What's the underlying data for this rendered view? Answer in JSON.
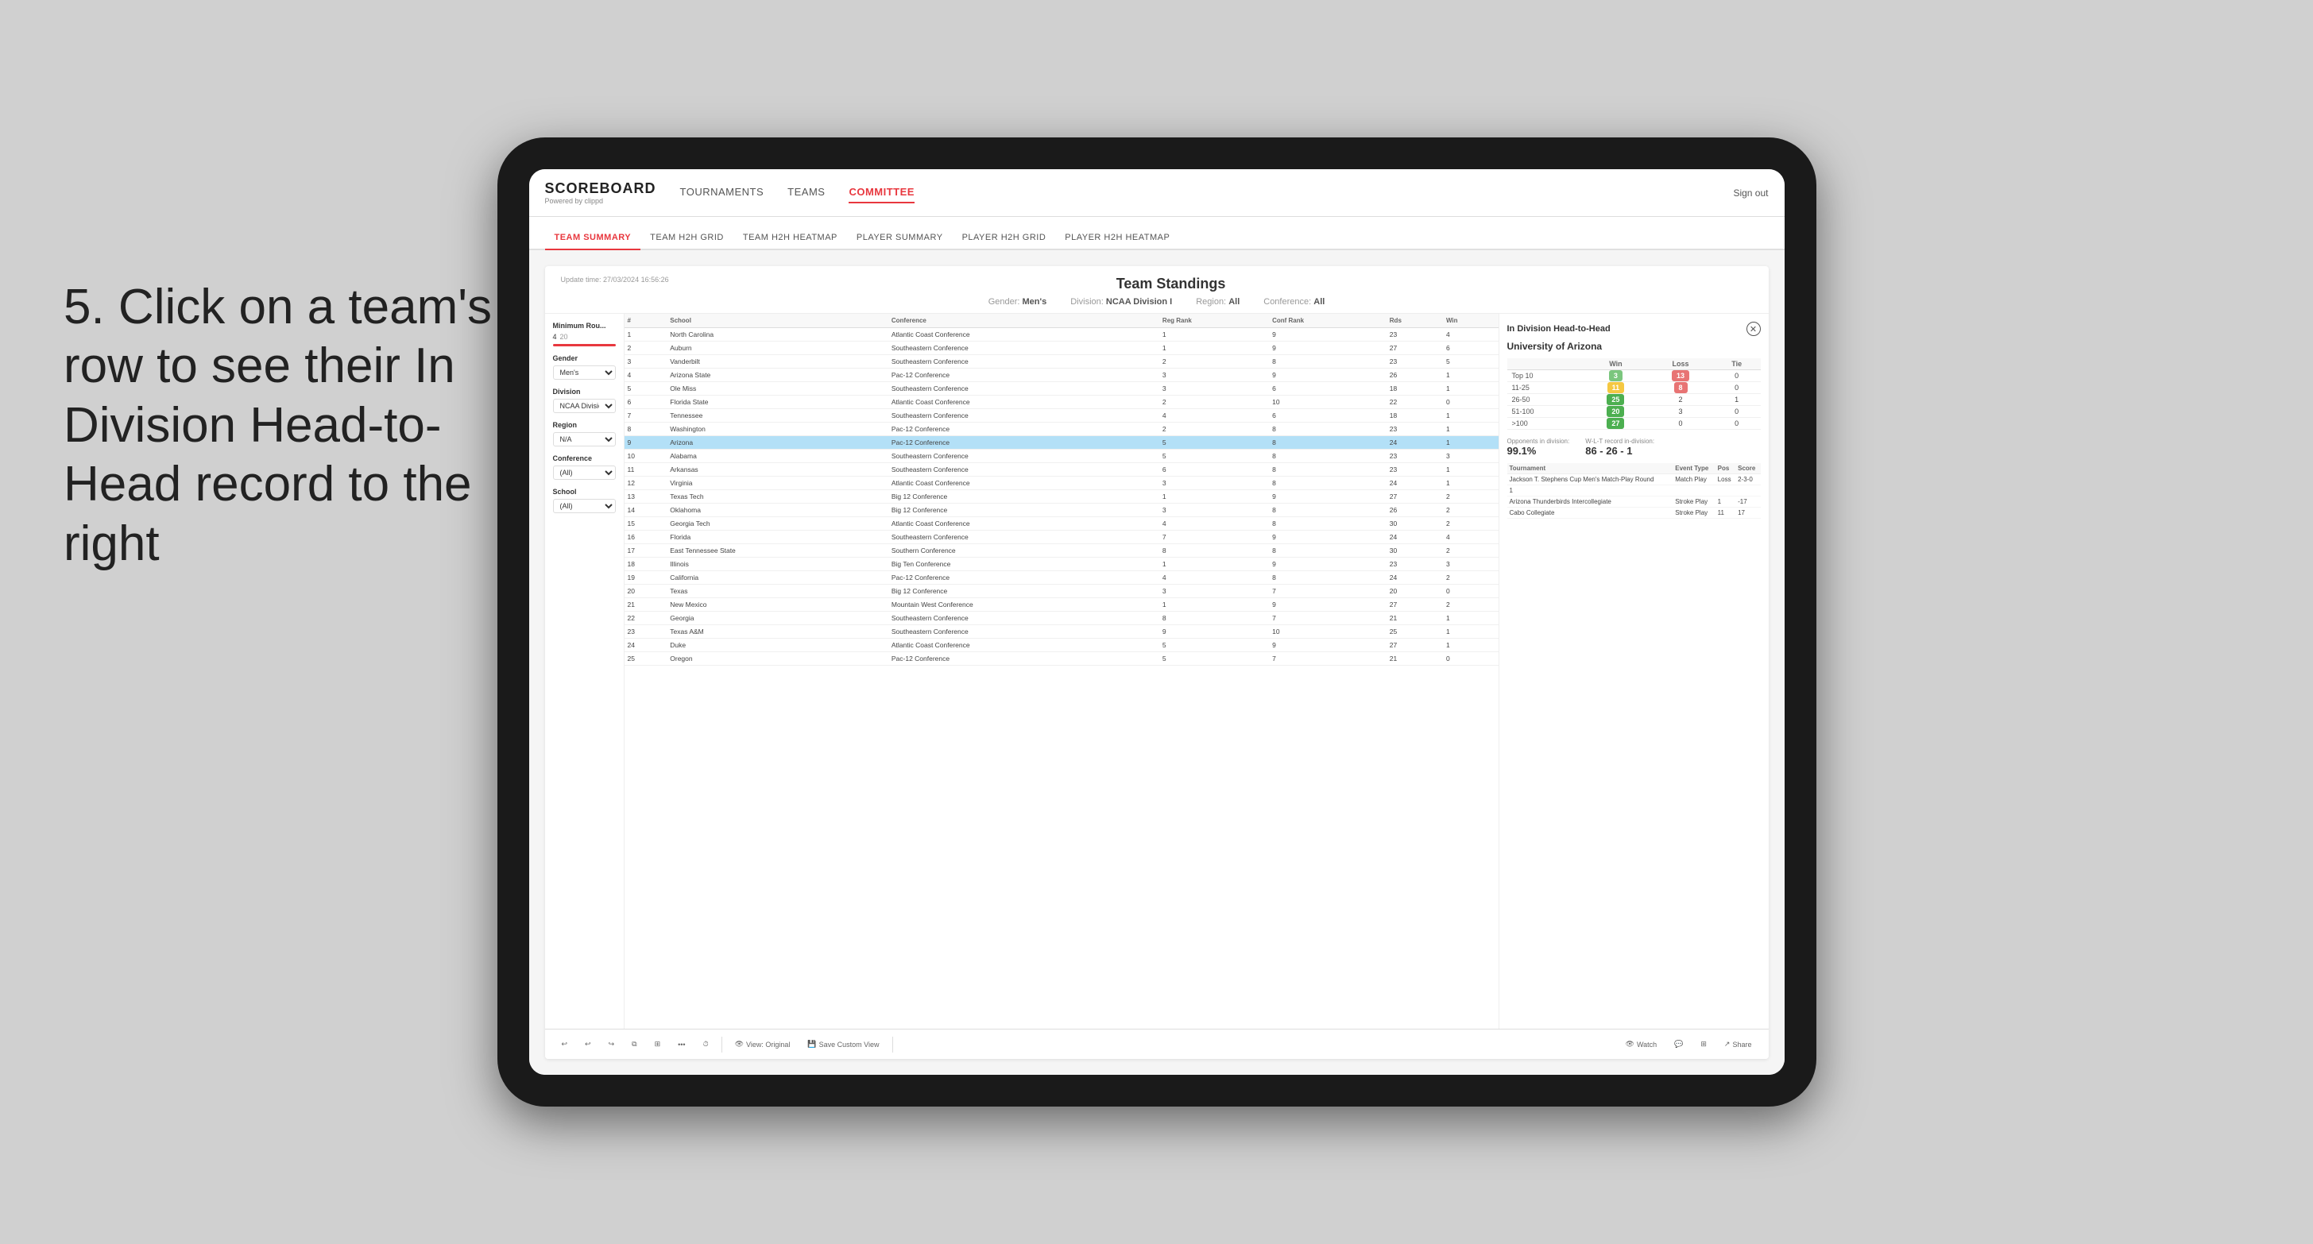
{
  "annotation": {
    "text": "5. Click on a team's row to see their In Division Head-to-Head record to the right"
  },
  "app": {
    "logo": "SCOREBOARD",
    "logo_sub": "Powered by clippd",
    "nav_items": [
      "TOURNAMENTS",
      "TEAMS",
      "COMMITTEE"
    ],
    "active_nav": "COMMITTEE",
    "sign_out": "Sign out"
  },
  "sub_nav": {
    "items": [
      "TEAM SUMMARY",
      "TEAM H2H GRID",
      "TEAM H2H HEATMAP",
      "PLAYER SUMMARY",
      "PLAYER H2H GRID",
      "PLAYER H2H HEATMAP"
    ],
    "active": "PLAYER SUMMARY"
  },
  "card": {
    "update_time": "Update time: 27/03/2024 16:56:26",
    "title": "Team Standings",
    "filters": {
      "gender_label": "Gender:",
      "gender_value": "Men's",
      "division_label": "Division:",
      "division_value": "NCAA Division I",
      "region_label": "Region:",
      "region_value": "All",
      "conference_label": "Conference:",
      "conference_value": "All"
    }
  },
  "left_filters": {
    "min_rounds_label": "Minimum Rou...",
    "min_rounds_value": "4",
    "min_rounds_max": "20",
    "gender_label": "Gender",
    "gender_value": "Men's",
    "division_label": "Division",
    "division_value": "NCAA Division I",
    "region_label": "Region",
    "region_value": "N/A",
    "conference_label": "Conference",
    "conference_value": "(All)",
    "school_label": "School",
    "school_value": "(All)"
  },
  "table": {
    "columns": [
      "#",
      "School",
      "Conference",
      "Reg Rank",
      "Conf Rank",
      "Rds",
      "Win"
    ],
    "rows": [
      {
        "rank": 1,
        "school": "North Carolina",
        "conference": "Atlantic Coast Conference",
        "reg_rank": 1,
        "conf_rank": 9,
        "rds": 23,
        "win": 4
      },
      {
        "rank": 2,
        "school": "Auburn",
        "conference": "Southeastern Conference",
        "reg_rank": 1,
        "conf_rank": 9,
        "rds": 27,
        "win": 6
      },
      {
        "rank": 3,
        "school": "Vanderbilt",
        "conference": "Southeastern Conference",
        "reg_rank": 2,
        "conf_rank": 8,
        "rds": 23,
        "win": 5
      },
      {
        "rank": 4,
        "school": "Arizona State",
        "conference": "Pac-12 Conference",
        "reg_rank": 3,
        "conf_rank": 9,
        "rds": 26,
        "win": 1
      },
      {
        "rank": 5,
        "school": "Ole Miss",
        "conference": "Southeastern Conference",
        "reg_rank": 3,
        "conf_rank": 6,
        "rds": 18,
        "win": 1
      },
      {
        "rank": 6,
        "school": "Florida State",
        "conference": "Atlantic Coast Conference",
        "reg_rank": 2,
        "conf_rank": 10,
        "rds": 22,
        "win": 0
      },
      {
        "rank": 7,
        "school": "Tennessee",
        "conference": "Southeastern Conference",
        "reg_rank": 4,
        "conf_rank": 6,
        "rds": 18,
        "win": 1
      },
      {
        "rank": 8,
        "school": "Washington",
        "conference": "Pac-12 Conference",
        "reg_rank": 2,
        "conf_rank": 8,
        "rds": 23,
        "win": 1
      },
      {
        "rank": 9,
        "school": "Arizona",
        "conference": "Pac-12 Conference",
        "reg_rank": 5,
        "conf_rank": 8,
        "rds": 24,
        "win": 1,
        "selected": true
      },
      {
        "rank": 10,
        "school": "Alabama",
        "conference": "Southeastern Conference",
        "reg_rank": 5,
        "conf_rank": 8,
        "rds": 23,
        "win": 3
      },
      {
        "rank": 11,
        "school": "Arkansas",
        "conference": "Southeastern Conference",
        "reg_rank": 6,
        "conf_rank": 8,
        "rds": 23,
        "win": 1
      },
      {
        "rank": 12,
        "school": "Virginia",
        "conference": "Atlantic Coast Conference",
        "reg_rank": 3,
        "conf_rank": 8,
        "rds": 24,
        "win": 1
      },
      {
        "rank": 13,
        "school": "Texas Tech",
        "conference": "Big 12 Conference",
        "reg_rank": 1,
        "conf_rank": 9,
        "rds": 27,
        "win": 2
      },
      {
        "rank": 14,
        "school": "Oklahoma",
        "conference": "Big 12 Conference",
        "reg_rank": 3,
        "conf_rank": 8,
        "rds": 26,
        "win": 2
      },
      {
        "rank": 15,
        "school": "Georgia Tech",
        "conference": "Atlantic Coast Conference",
        "reg_rank": 4,
        "conf_rank": 8,
        "rds": 30,
        "win": 2
      },
      {
        "rank": 16,
        "school": "Florida",
        "conference": "Southeastern Conference",
        "reg_rank": 7,
        "conf_rank": 9,
        "rds": 24,
        "win": 4
      },
      {
        "rank": 17,
        "school": "East Tennessee State",
        "conference": "Southern Conference",
        "reg_rank": 8,
        "conf_rank": 8,
        "rds": 30,
        "win": 2
      },
      {
        "rank": 18,
        "school": "Illinois",
        "conference": "Big Ten Conference",
        "reg_rank": 1,
        "conf_rank": 9,
        "rds": 23,
        "win": 3
      },
      {
        "rank": 19,
        "school": "California",
        "conference": "Pac-12 Conference",
        "reg_rank": 4,
        "conf_rank": 8,
        "rds": 24,
        "win": 2
      },
      {
        "rank": 20,
        "school": "Texas",
        "conference": "Big 12 Conference",
        "reg_rank": 3,
        "conf_rank": 7,
        "rds": 20,
        "win": 0
      },
      {
        "rank": 21,
        "school": "New Mexico",
        "conference": "Mountain West Conference",
        "reg_rank": 1,
        "conf_rank": 9,
        "rds": 27,
        "win": 2
      },
      {
        "rank": 22,
        "school": "Georgia",
        "conference": "Southeastern Conference",
        "reg_rank": 8,
        "conf_rank": 7,
        "rds": 21,
        "win": 1
      },
      {
        "rank": 23,
        "school": "Texas A&M",
        "conference": "Southeastern Conference",
        "reg_rank": 9,
        "conf_rank": 10,
        "rds": 25,
        "win": 1
      },
      {
        "rank": 24,
        "school": "Duke",
        "conference": "Atlantic Coast Conference",
        "reg_rank": 5,
        "conf_rank": 9,
        "rds": 27,
        "win": 1
      },
      {
        "rank": 25,
        "school": "Oregon",
        "conference": "Pac-12 Conference",
        "reg_rank": 5,
        "conf_rank": 7,
        "rds": 21,
        "win": 0
      }
    ]
  },
  "h2h": {
    "title": "In Division Head-to-Head",
    "team": "University of Arizona",
    "columns": [
      "",
      "Win",
      "Loss",
      "Tie"
    ],
    "rows": [
      {
        "range": "Top 10",
        "win": 3,
        "loss": 13,
        "tie": 0,
        "win_color": "green",
        "loss_color": "red"
      },
      {
        "range": "11-25",
        "win": 11,
        "loss": 8,
        "tie": 0,
        "win_color": "yellow",
        "loss_color": "yellow"
      },
      {
        "range": "26-50",
        "win": 25,
        "loss": 2,
        "tie": 1,
        "win_color": "dk-green",
        "loss_color": ""
      },
      {
        "range": "51-100",
        "win": 20,
        "loss": 3,
        "tie": 0,
        "win_color": "dk-green",
        "loss_color": ""
      },
      {
        "range": ">100",
        "win": 27,
        "loss": 0,
        "tie": 0,
        "win_color": "dk-green",
        "loss_color": ""
      }
    ],
    "opponents_label": "Opponents in division:",
    "opponents_value": "99.1%",
    "record_label": "W-L-T record in-division:",
    "record_value": "86 - 26 - 1",
    "tournament_label": "Tournament",
    "tournament_columns": [
      "Tournament",
      "Event Type",
      "Pos",
      "Score"
    ],
    "tournaments": [
      {
        "name": "Jackson T. Stephens Cup Men's Match-Play Round",
        "event_type": "Match Play",
        "pos": "Loss",
        "score": "2-3-0"
      },
      {
        "name": "1",
        "event_type": "",
        "pos": "",
        "score": ""
      },
      {
        "name": "Arizona Thunderbirds Intercollegiate",
        "event_type": "Stroke Play",
        "pos": "1",
        "score": "-17"
      },
      {
        "name": "Cabo Collegiate",
        "event_type": "Stroke Play",
        "pos": "11",
        "score": "17"
      }
    ]
  },
  "toolbar": {
    "undo": "↩",
    "redo": "↪",
    "view_original": "View: Original",
    "save_custom": "Save Custom View",
    "watch": "Watch",
    "share": "Share"
  }
}
